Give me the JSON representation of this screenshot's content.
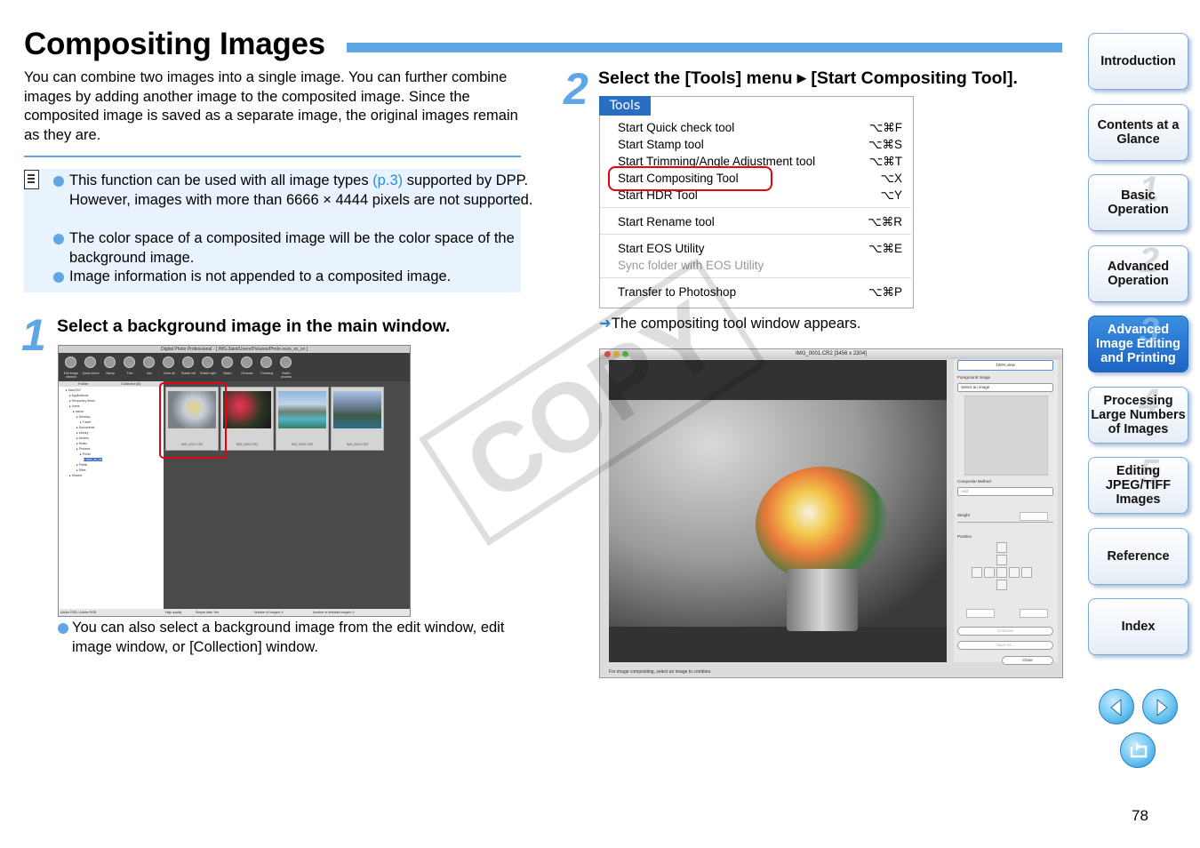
{
  "title": "Compositing Images",
  "intro": "You can combine two images into a single image. You can further combine images by adding another image to the composited image. Since the composited image is saved as a separate image, the original images remain as they are.",
  "note": {
    "items": [
      {
        "pre": "This function can be used with all image types ",
        "link": "(p.3)",
        "post": " supported by DPP. However, images with more than 6666 × 4444 pixels are not supported."
      },
      {
        "text": "The color space of a composited image will be the color space of the background image."
      },
      {
        "text": "Image information is not appended to a composited image."
      }
    ]
  },
  "step1": {
    "number": "1",
    "text": "Select a background image in the main window.",
    "caption": "You can also select a background image from the edit window, edit image window, or [Collection] window.",
    "screenshot": {
      "window_title": "Digital Photo Professional - [ /MG-3aint/Users/Pictures/Photo-xxxx_xx_xx ]",
      "toolbar": [
        "Edit image window",
        "Quick check",
        "Stamp",
        "Trim",
        "Info",
        "Clear all",
        "Rotate left",
        "Rotate right",
        "Batch",
        "Rename",
        "Trimming",
        "Batch process"
      ],
      "tabs": [
        "Folder",
        "Collection(0)"
      ],
      "tree": [
        "MacOSX",
        "Applications",
        "Temporary Items",
        "Users",
        "canon",
        "Desktop",
        "Travel",
        "Documents",
        "Library",
        "Movies",
        "Music",
        "Pictures",
        "Photo",
        "xxxx_xx_xx",
        "Public",
        "Sites",
        "Shared"
      ],
      "thumbs": [
        "IMG_0001.CR2",
        "IMG_0002.CR2",
        "IMG_0003.CR2",
        "IMG_0004.CR2"
      ],
      "status": [
        "Adobe RGB / Adobe RGB",
        "High quality",
        "Simple data: Yes",
        "Number of images: 4",
        "Number of selected images: 0"
      ]
    }
  },
  "step2": {
    "number": "2",
    "text_pre": "Select the [Tools] menu",
    "text_post": "[Start Compositing Tool].",
    "menu": {
      "tab": "Tools",
      "groups": [
        [
          {
            "label": "Start Quick check tool",
            "shortcut": "⌥⌘F"
          },
          {
            "label": "Start Stamp tool",
            "shortcut": "⌥⌘S"
          },
          {
            "label": "Start Trimming/Angle Adjustment tool",
            "shortcut": "⌥⌘T"
          },
          {
            "label": "Start Compositing Tool",
            "shortcut": "⌥X"
          },
          {
            "label": "Start HDR Tool",
            "shortcut": "⌥Y"
          }
        ],
        [
          {
            "label": "Start Rename tool",
            "shortcut": "⌥⌘R"
          }
        ],
        [
          {
            "label": "Start EOS Utility",
            "shortcut": "⌥⌘E"
          },
          {
            "label": "Sync folder with EOS Utility",
            "shortcut": "",
            "disabled": true
          }
        ],
        [
          {
            "label": "Transfer to Photoshop",
            "shortcut": "⌥⌘P"
          }
        ]
      ]
    },
    "result": "The compositing tool window appears.",
    "screenshot": {
      "window_title": "IMG_0001.CR2 [3456 x 2304]",
      "zoom": "100% view",
      "foreground_label": "Foreground Image",
      "foreground_select": "Select an image",
      "method_label": "Composite Method",
      "method_value": "Add",
      "weight_label": "Weight",
      "position_label": "Position",
      "continue": "Continue",
      "save_as": "Save As...",
      "close": "Close",
      "status": "For image compositing, select an image to combine."
    }
  },
  "watermark": "COPY",
  "sidebar": [
    {
      "label": "Introduction",
      "number": ""
    },
    {
      "label": "Contents at a Glance",
      "number": ""
    },
    {
      "label": "Basic Operation",
      "number": "1"
    },
    {
      "label": "Advanced Operation",
      "number": "2"
    },
    {
      "label": "Advanced Image Editing and Printing",
      "number": "3",
      "active": true
    },
    {
      "label": "Processing Large Numbers of Images",
      "number": "4"
    },
    {
      "label": "Editing JPEG/TIFF Images",
      "number": "5"
    },
    {
      "label": "Reference",
      "number": ""
    },
    {
      "label": "Index",
      "number": ""
    }
  ],
  "nav_icons": [
    "previous-page-icon",
    "next-page-icon",
    "return-icon"
  ],
  "page_number": "78",
  "colors": {
    "accent": "#5ea6e6",
    "link": "#2a8bde",
    "highlight": "#e60012",
    "active_nav": "#1d64c4"
  }
}
